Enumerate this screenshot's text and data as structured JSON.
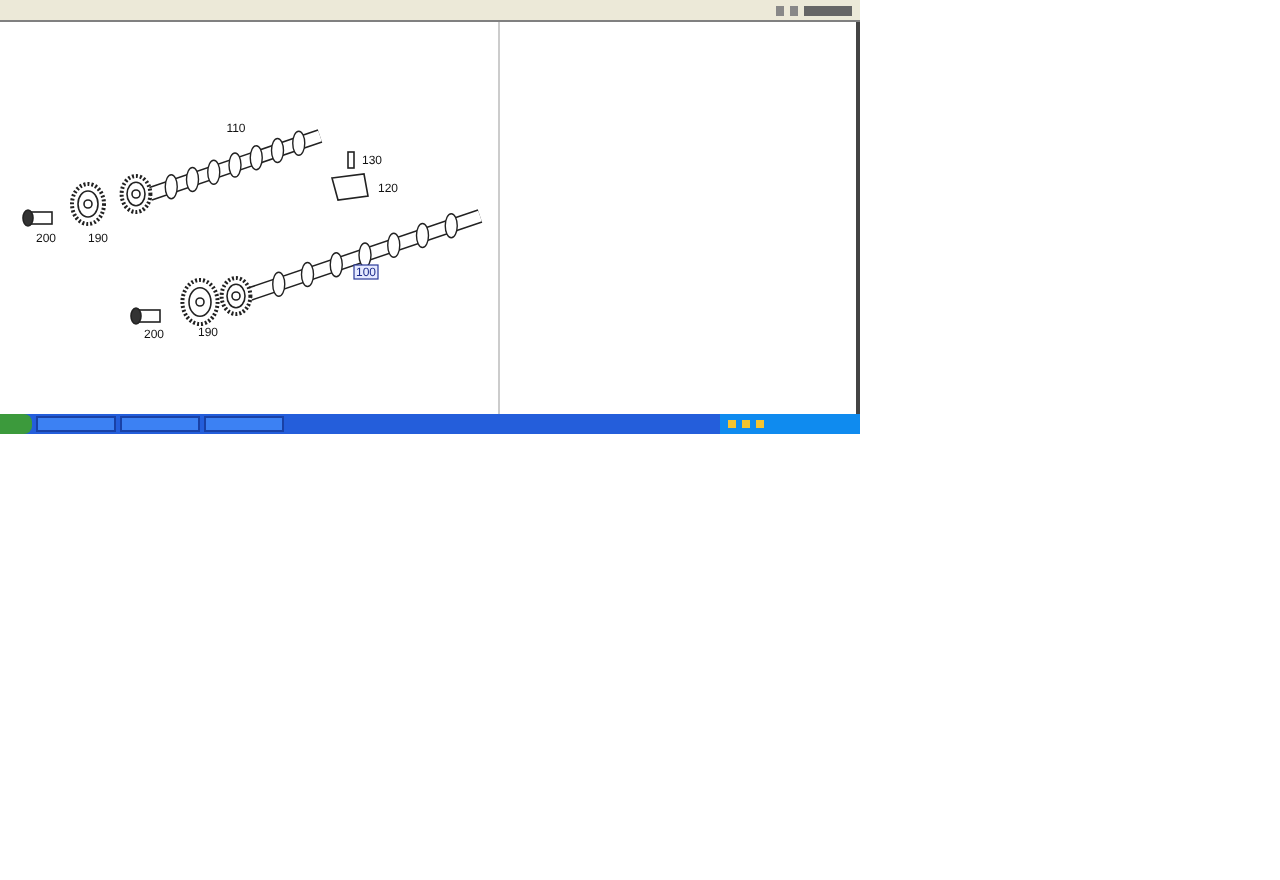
{
  "diagram": {
    "callouts": [
      {
        "label": "110",
        "selected": false
      },
      {
        "label": "130",
        "selected": false
      },
      {
        "label": "120",
        "selected": false
      },
      {
        "label": "200",
        "selected": false
      },
      {
        "label": "190",
        "selected": false
      },
      {
        "label": "100",
        "selected": true
      },
      {
        "label": "200",
        "selected": false
      },
      {
        "label": "190",
        "selected": false
      }
    ]
  }
}
